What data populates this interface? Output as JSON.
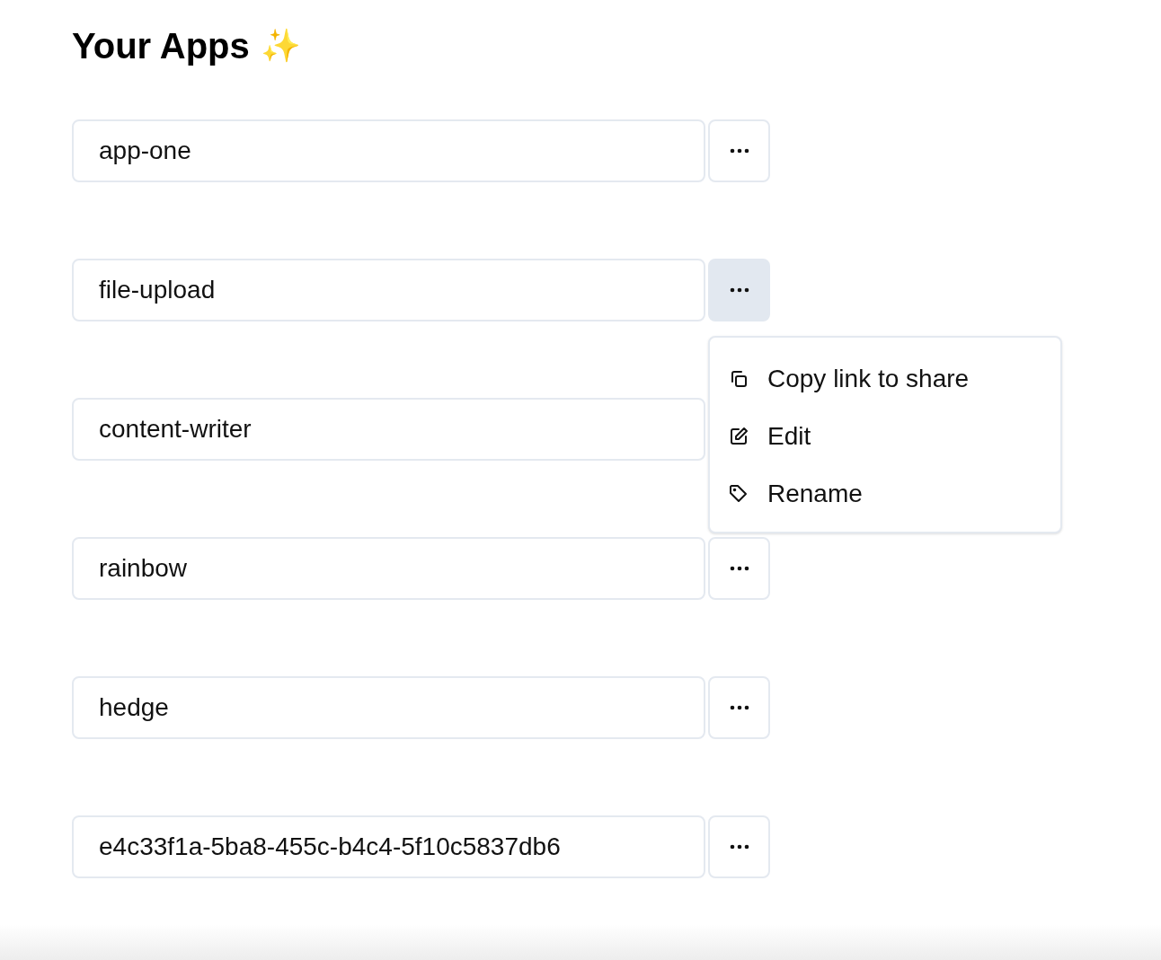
{
  "title": "Your Apps",
  "title_emoji": "✨",
  "apps": [
    {
      "name": "app-one",
      "menu_open": false
    },
    {
      "name": "file-upload",
      "menu_open": true
    },
    {
      "name": "content-writer",
      "menu_open": false
    },
    {
      "name": "rainbow",
      "menu_open": false
    },
    {
      "name": "hedge",
      "menu_open": false
    },
    {
      "name": "e4c33f1a-5ba8-455c-b4c4-5f10c5837db6",
      "menu_open": false
    }
  ],
  "menu_items": [
    {
      "kind": "copy",
      "label": "Copy link to share"
    },
    {
      "kind": "edit",
      "label": "Edit"
    },
    {
      "kind": "tag",
      "label": "Rename"
    }
  ]
}
